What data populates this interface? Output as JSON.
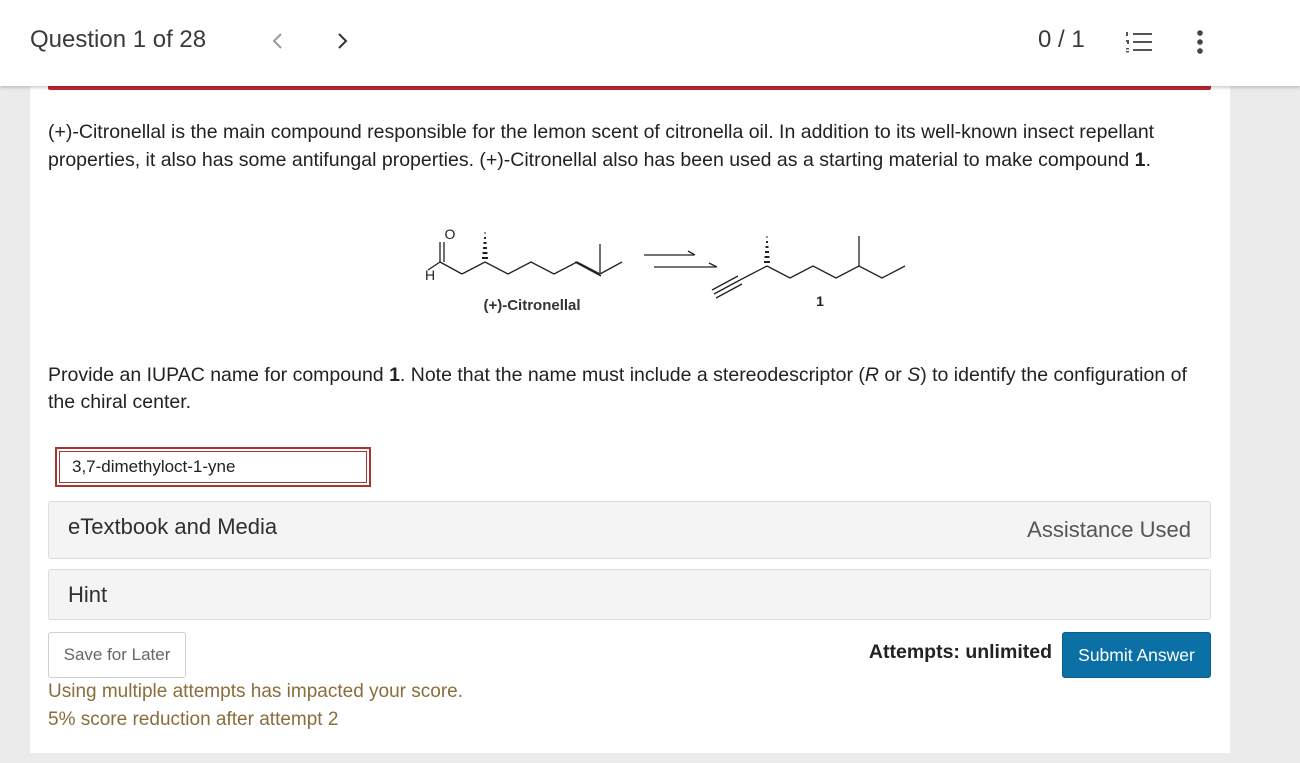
{
  "header": {
    "question_label": "Question 1 of 28",
    "score": "0 / 1",
    "icons": [
      "chevron-left-icon",
      "chevron-right-icon",
      "numbered-list-icon",
      "vertical-dots-icon"
    ]
  },
  "question": {
    "intro_pre": "(+)-Citronellal is the main compound responsible for the lemon scent of citronella oil. In addition to its well-known insect repellant properties, it also has some antifungal properties. (+)-Citronellal also has been used as a starting material to make compound ",
    "intro_bold": "1",
    "intro_post": ".",
    "diagram": {
      "aldehyde_o": "O",
      "aldehyde_h": "H",
      "reactant_label": "(+)-Citronellal",
      "product_label": "1"
    },
    "prompt_pre": "Provide an IUPAC name for compound ",
    "prompt_bold": "1",
    "prompt_mid1": ". Note that the name must include a stereodescriptor (",
    "prompt_r": "R",
    "prompt_or": " or ",
    "prompt_s": "S",
    "prompt_post": ") to identify the configuration of the chiral center."
  },
  "answer": {
    "value": "3,7-dimethyloct-1-yne"
  },
  "panels": {
    "etextbook_label": "eTextbook and Media",
    "assistance_label": "Assistance Used",
    "hint_label": "Hint"
  },
  "footer": {
    "save_label": "Save for Later",
    "attempts_label": "Attempts: unlimited",
    "submit_label": "Submit Answer",
    "penalty_line1": "Using multiple attempts has impacted your score.",
    "penalty_line2": "5% score reduction after attempt 2"
  },
  "colors": {
    "accent": "#0a70a6",
    "error": "#c1272d",
    "penalty_text": "#8a6d3b"
  }
}
